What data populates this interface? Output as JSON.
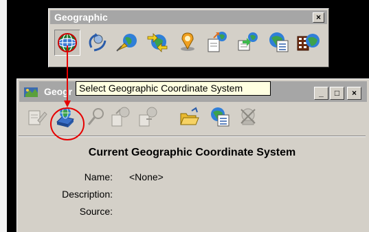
{
  "toolbar": {
    "title": "Geographic",
    "close_glyph": "×",
    "tools": [
      {
        "icon": "globe-grid-icon",
        "pressed": true
      },
      {
        "icon": "rotate-view-icon"
      },
      {
        "icon": "globe-pin-icon"
      },
      {
        "icon": "globe-arrows-icon"
      },
      {
        "icon": "place-marker-icon"
      },
      {
        "icon": "export-globe-icon"
      },
      {
        "icon": "import-globe-icon"
      },
      {
        "icon": "globe-list-icon"
      },
      {
        "icon": "film-globe-icon"
      }
    ]
  },
  "dialog": {
    "title": "Geogr",
    "minimize_glyph": "_",
    "maximize_glyph": "□",
    "close_glyph": "×",
    "tools": [
      {
        "icon": "doc-edit-icon"
      },
      {
        "icon": "select-gcs-icon",
        "highlighted": true
      },
      {
        "icon": "pin-icon"
      },
      {
        "icon": "export-gcs-icon"
      },
      {
        "icon": "import-gcs-icon"
      },
      {
        "icon": "open-folder-icon"
      },
      {
        "icon": "globe-list-icon"
      },
      {
        "icon": "delete-gcs-icon"
      }
    ],
    "section_title": "Current Geographic Coordinate System",
    "fields": [
      {
        "label": "Name:",
        "value": "<None>"
      },
      {
        "label": "Description:",
        "value": ""
      },
      {
        "label": "Source:",
        "value": ""
      }
    ]
  },
  "tooltip": {
    "text": "Select Geographic Coordinate System"
  },
  "colors": {
    "annotation": "#e60000",
    "panel": "#d4d0c8",
    "titlebar_inactive": "#a6a6a6",
    "tooltip_bg": "#ffffe1"
  }
}
